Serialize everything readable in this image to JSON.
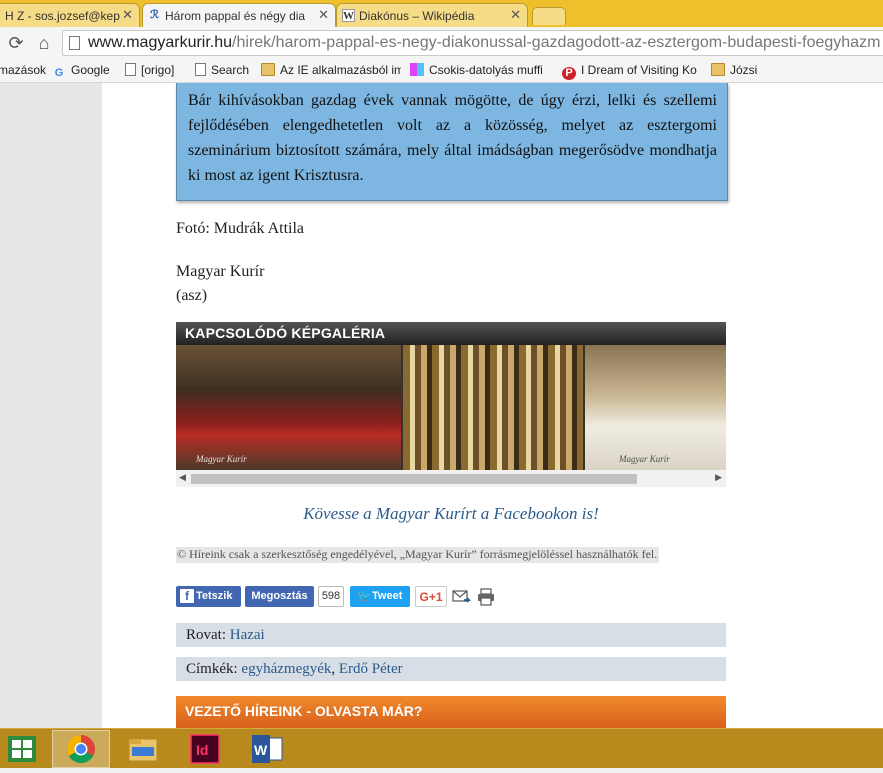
{
  "browser": {
    "tabs": [
      {
        "label": "H Z - sos.jozsef@kep",
        "icon": "mail-icon"
      },
      {
        "label": "Három pappal és négy dia",
        "icon": "magyar-kurir-icon",
        "active": true
      },
      {
        "label": "Diakónus – Wikipédia",
        "icon": "wikipedia-icon"
      }
    ],
    "url": {
      "host": "www.magyarkurir.hu",
      "path": "/hirek/harom-pappal-es-negy-diakonussal-gazdagodott-az-esztergom-budapesti-foegyhazm"
    },
    "bookmarks": [
      {
        "label": "mazások",
        "icon": "none"
      },
      {
        "label": "Google",
        "icon": "google-icon"
      },
      {
        "label": "[origo]",
        "icon": "page-icon"
      },
      {
        "label": "Search",
        "icon": "page-icon"
      },
      {
        "label": "Az IE alkalmazásból im",
        "icon": "folder-icon"
      },
      {
        "label": "Csokis-datolyás muffi",
        "icon": "colorful-icon"
      },
      {
        "label": "I Dream of Visiting Ko",
        "icon": "pinterest-icon"
      },
      {
        "label": "Józsi",
        "icon": "folder-icon"
      }
    ]
  },
  "article": {
    "quote": "Bár kihívásokban gazdag évek vannak mögötte, de úgy érzi, lelki és szellemi fejlődésében elengedhetetlen volt az a közösség, melyet az esztergomi szeminárium biztosított számára, mely által imádságban megerősödve mondhatja ki most az igent Krisztusra.",
    "photo_credit": "Fotó: Mudrák Attila",
    "source_line1": "Magyar Kurír",
    "source_line2": "(asz)",
    "gallery_title": "KAPCSOLÓDÓ KÉPGALÉRIA",
    "gallery_logo": "Magyar Kurír",
    "facebook_follow": "Kövesse a Magyar Kurírt a Facebookon is!",
    "copyright": "© Híreink csak a szerkesztőség engedélyével, „Magyar Kurír” forrásmegjelöléssel használhatók fel.",
    "social": {
      "like": "Tetszik",
      "share": "Megosztás",
      "share_count": "598",
      "tweet": "Tweet",
      "gplus": "G+1"
    },
    "rovat_label": "Rovat:",
    "rovat_value": "Hazai",
    "cimkek_label": "Címkék:",
    "cimkek_values": [
      "egyházmegyék",
      "Erdő Péter"
    ],
    "leading_header": "VEZETŐ HÍREINK - OLVASTA MÁR?"
  },
  "taskbar": [
    "start-icon",
    "chrome-icon",
    "file-explorer-icon",
    "indesign-icon",
    "word-icon"
  ],
  "colors": {
    "tabstrip": "#f0c02c",
    "quote_bg": "#7db6e0",
    "link": "#2a5a8c",
    "taskbar": "#b8891c",
    "leading_header": "#e5732a"
  }
}
